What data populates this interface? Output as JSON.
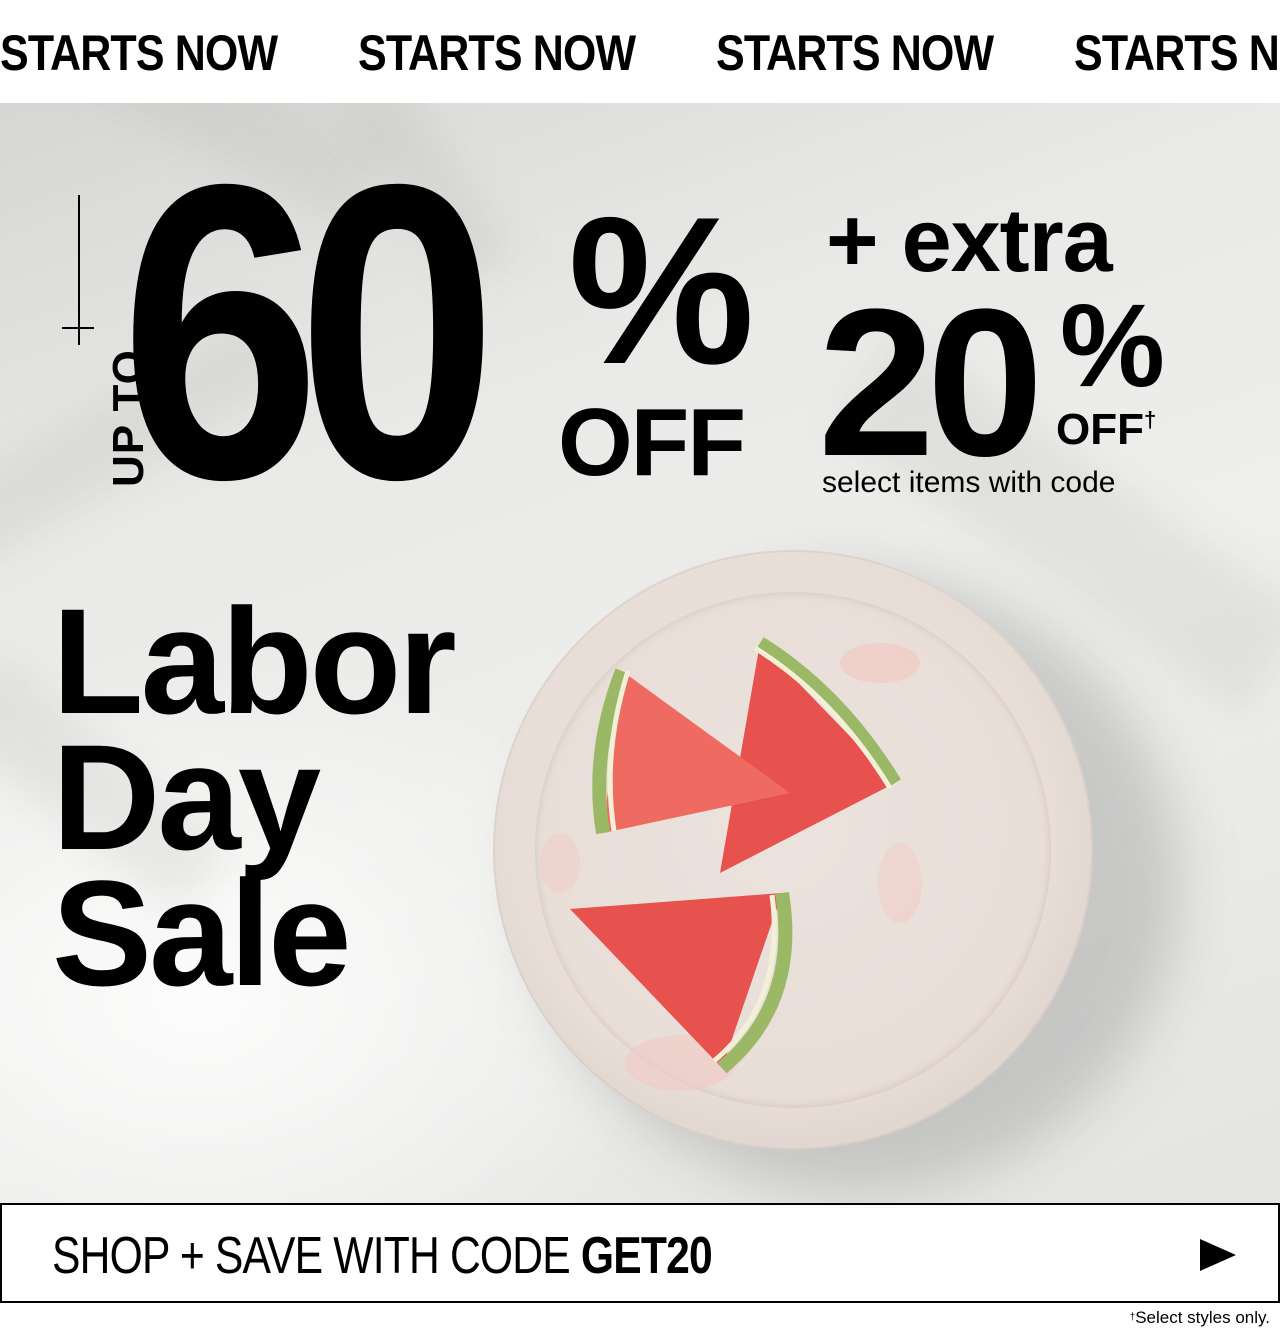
{
  "ticker": {
    "items": [
      "STARTS NOW",
      "STARTS NOW",
      "STARTS NOW",
      "STARTS NOW"
    ]
  },
  "hero": {
    "upto_label": "UP TO",
    "main_discount": "60",
    "main_percent": "%",
    "main_off": "OFF",
    "extra_label": "+ extra",
    "extra_discount": "20",
    "extra_percent": "%",
    "extra_off": "OFF",
    "extra_dagger": "†",
    "extra_note": "select items with code",
    "headline_lines": [
      "Labor",
      "Day",
      "Sale"
    ]
  },
  "cta": {
    "label": "SHOP + SAVE WITH CODE ",
    "code": "GET20",
    "arrow_icon": "play-arrow-icon"
  },
  "footnote": {
    "dagger": "†",
    "text": "Select styles only."
  },
  "colors": {
    "text": "#000000",
    "background": "#ffffff",
    "hero_bg": "#e9e9e7",
    "plate": "#e8ddd7",
    "melon_flesh": "#e8524e",
    "melon_rind": "#8fae5a"
  }
}
